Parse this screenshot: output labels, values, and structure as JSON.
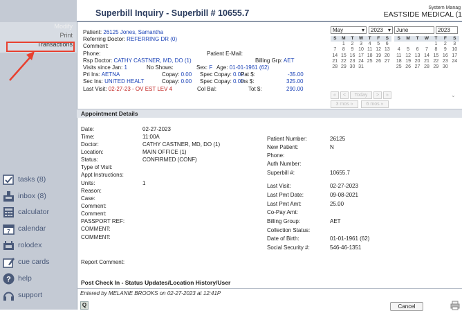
{
  "header": {
    "title": "Superbill Inquiry - Superbill # 10655.7",
    "system_label": "System Manag",
    "practice": "EASTSIDE MEDICAL (1"
  },
  "sidebar": {
    "links": {
      "modify": "Modify",
      "print": "Print",
      "transactions": "Transactions"
    },
    "tools": [
      {
        "label": "tasks (8)",
        "icon": "tasks-icon"
      },
      {
        "label": "inbox (8)",
        "icon": "inbox-icon"
      },
      {
        "label": "calculator",
        "icon": "calculator-icon"
      },
      {
        "label": "calendar",
        "icon": "calendar-icon"
      },
      {
        "label": "rolodex",
        "icon": "rolodex-icon"
      },
      {
        "label": "cue cards",
        "icon": "cue-cards-icon"
      },
      {
        "label": "help",
        "icon": "help-icon"
      },
      {
        "label": "support",
        "icon": "support-icon"
      }
    ],
    "highlight_color": "#e8402f"
  },
  "patient": {
    "patient_label": "Patient:",
    "patient": "26125 Jones, Samantha",
    "ref_label": "Referring Doctor:",
    "ref": "REFERRING DR (0)",
    "comment_label": "Comment:",
    "phone_label": "Phone:",
    "email_label": "Patient E-Mail:",
    "rsp_label": "Rsp Doctor:",
    "rsp": "CATHY CASTNER, MD, DO (1)",
    "bgrp_label": "Billing Grp:",
    "bgrp": "AET",
    "visits_label": "Visits since Jan:",
    "visits": "1",
    "noshows_label": "No Shows:",
    "sex_label": "Sex:",
    "sex": "F",
    "age_label": "Age:",
    "age": "01-01-1961 (62)",
    "pri_label": "Pri Ins:",
    "pri": "AETNA",
    "sec_label": "Sec Ins:",
    "sec": "UNITED HEALT",
    "copay_label": "Copay:",
    "copay1": "0.00",
    "copay2": "0.00",
    "spec_label": "Spec Copay:",
    "spec1": "0.00",
    "spec2": "0.00",
    "pat_label": "Pat $:",
    "pat": "-35.00",
    "ins_label": "Ins $:",
    "ins": "325.00",
    "last_label": "Last Visit:",
    "last": "02-27-23 - OV EST LEV 4",
    "colbal_label": "Col Bal:",
    "tot_label": "Tot $:",
    "tot": "290.00"
  },
  "calendar": {
    "month1": "May",
    "year1": "2023",
    "month2": "June",
    "year2": "2023",
    "days_header": [
      "S",
      "M",
      "T",
      "W",
      "T",
      "F",
      "S"
    ],
    "may": [
      [
        "",
        "1",
        "2",
        "3",
        "4",
        "5",
        "6"
      ],
      [
        "7",
        "8",
        "9",
        "10",
        "11",
        "12",
        "13"
      ],
      [
        "14",
        "15",
        "16",
        "17",
        "18",
        "19",
        "20"
      ],
      [
        "21",
        "22",
        "23",
        "24",
        "25",
        "26",
        "27"
      ],
      [
        "28",
        "29",
        "30",
        "31",
        "",
        "",
        ""
      ]
    ],
    "june": [
      [
        "",
        "",
        "",
        "",
        "1",
        "2",
        "3"
      ],
      [
        "4",
        "5",
        "6",
        "7",
        "8",
        "9",
        "10"
      ],
      [
        "11",
        "12",
        "13",
        "14",
        "15",
        "16",
        "17"
      ],
      [
        "18",
        "19",
        "20",
        "21",
        "22",
        "23",
        "24"
      ],
      [
        "25",
        "26",
        "27",
        "28",
        "29",
        "30",
        ""
      ]
    ],
    "btn_first": "«",
    "btn_prev": "<",
    "btn_today": "Today",
    "btn_next": ">",
    "btn_last": "»",
    "btn_back3": "3 mos »",
    "btn_fwd6": "6 mos »"
  },
  "appointment": {
    "heading": "Appointment Details",
    "left": [
      {
        "label": "Date:",
        "value": "02-27-2023"
      },
      {
        "label": "Time:",
        "value": "11:00A"
      },
      {
        "label": "Doctor:",
        "value": "CATHY CASTNER, MD, DO (1)"
      },
      {
        "label": "Location:",
        "value": "MAIN OFFICE (1)"
      },
      {
        "label": "Status:",
        "value": "CONFIRMED (CONF)"
      },
      {
        "label": "Type of Visit:",
        "value": ""
      },
      {
        "label": "Appt Instructions:",
        "value": ""
      },
      {
        "label": "Units:",
        "value": "1"
      },
      {
        "label": "Reason:",
        "value": ""
      },
      {
        "label": "Case:",
        "value": ""
      },
      {
        "label": "Comment:",
        "value": ""
      },
      {
        "label": "Comment:",
        "value": ""
      },
      {
        "label": "PASSPORT REF:",
        "value": ""
      },
      {
        "label": "COMMENT:",
        "value": ""
      },
      {
        "label": "COMMENT:",
        "value": ""
      },
      {
        "label": "Report Comment:",
        "value": ""
      }
    ],
    "right": [
      {
        "label": "Patient Number:",
        "value": "26125"
      },
      {
        "label": "New Patient:",
        "value": "N"
      },
      {
        "label": "Phone:",
        "value": ""
      },
      {
        "label": "Auth Number:",
        "value": ""
      },
      {
        "label": "Superbill #:",
        "value": "10655.7"
      },
      {
        "label": "Last Visit:",
        "value": "02-27-2023"
      },
      {
        "label": "Last Pmt Date:",
        "value": "09-08-2021"
      },
      {
        "label": "Last Pmt Amt:",
        "value": "25.00"
      },
      {
        "label": "Co-Pay Amt:",
        "value": ""
      },
      {
        "label": "Billing Group:",
        "value": "AET"
      },
      {
        "label": "Collection Status:",
        "value": ""
      },
      {
        "label": "Date of Birth:",
        "value": "01-01-1961 (62)"
      },
      {
        "label": "Social Security #:",
        "value": "546-46-1351"
      }
    ]
  },
  "post": {
    "heading": "Post Check In - Status Updates/Location History/User",
    "entered": "Entered by MELANIE BROOKS on 02-27-2023 at 12:41P",
    "q_label": "Q",
    "cancel_label": "Cancel"
  }
}
